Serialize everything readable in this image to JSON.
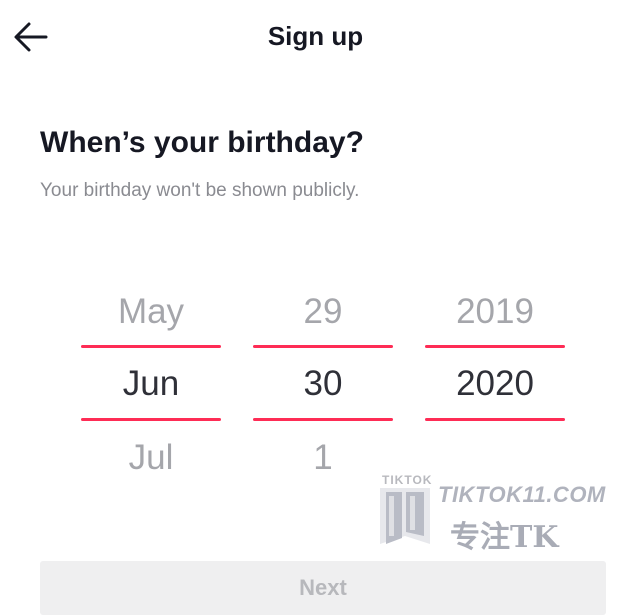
{
  "header": {
    "title": "Sign up",
    "back_icon": "arrow-left-icon"
  },
  "birthday": {
    "heading": "When’s your birthday?",
    "subtitle": "Your birthday won't be shown publicly."
  },
  "picker": {
    "accent_color": "#fe2c55",
    "month": {
      "prev": "May",
      "selected": "Jun",
      "next": "Jul"
    },
    "day": {
      "prev": "29",
      "selected": "30",
      "next": "1"
    },
    "year": {
      "prev": "2019",
      "selected": "2020",
      "next": ""
    }
  },
  "watermark": {
    "label_top": "TIKTOK",
    "site": "TIKTOK11.COM",
    "chinese": "专注TK"
  },
  "next_button": {
    "label": "Next"
  }
}
